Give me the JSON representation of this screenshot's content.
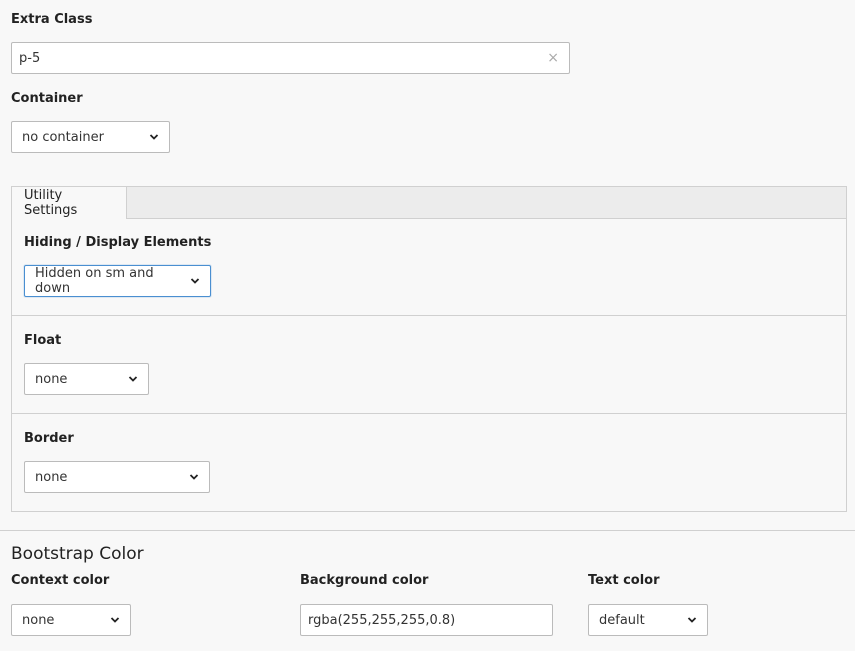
{
  "extra_class": {
    "label": "Extra Class",
    "value": "p-5",
    "clear_glyph": "×"
  },
  "container": {
    "label": "Container",
    "selected": "no container"
  },
  "utility": {
    "tab_label": "Utility Settings",
    "hiding": {
      "label": "Hiding / Display Elements",
      "selected": "Hidden on sm and down"
    },
    "float": {
      "label": "Float",
      "selected": "none"
    },
    "border": {
      "label": "Border",
      "selected": "none"
    }
  },
  "bootstrap_color": {
    "heading": "Bootstrap Color",
    "context": {
      "label": "Context color",
      "selected": "none"
    },
    "background": {
      "label": "Background color",
      "value": "rgba(255,255,255,0.8)"
    },
    "text": {
      "label": "Text color",
      "selected": "default"
    }
  },
  "colors": {
    "page_bg": "#f8f8f8",
    "border": "#bbbbbb",
    "focus": "#4a8fd1"
  }
}
